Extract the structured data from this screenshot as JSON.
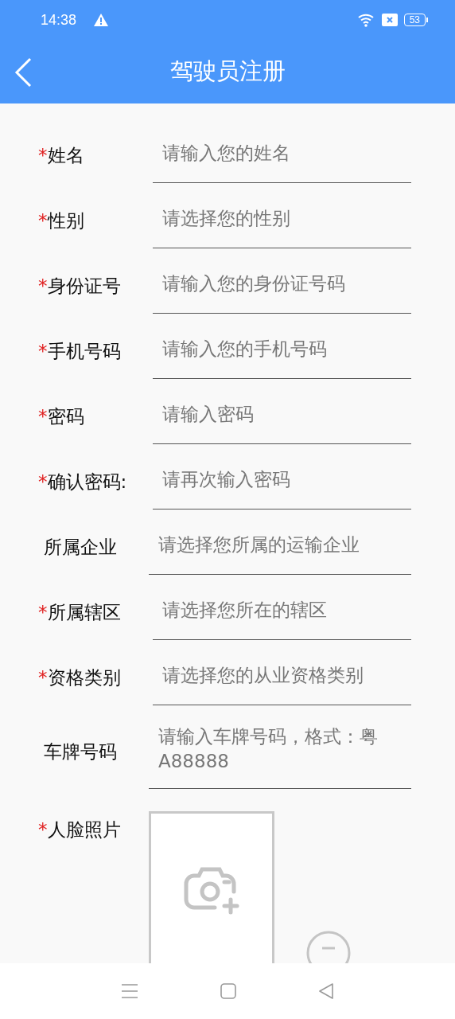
{
  "status_bar": {
    "time": "14:38",
    "battery": "53"
  },
  "header": {
    "title": "驾驶员注册"
  },
  "fields": [
    {
      "mark": "*",
      "label": "姓名",
      "placeholder": "请输入您的姓名"
    },
    {
      "mark": "*",
      "label": "性别",
      "placeholder": "请选择您的性别"
    },
    {
      "mark": "*",
      "label": "身份证号",
      "placeholder": "请输入您的身份证号码"
    },
    {
      "mark": "*",
      "label": "手机号码",
      "placeholder": "请输入您的手机号码"
    },
    {
      "mark": "*",
      "label": "密码",
      "placeholder": "请输入密码"
    },
    {
      "mark": "*",
      "label": "确认密码:",
      "placeholder": "请再次输入密码"
    },
    {
      "label": "所属企业",
      "placeholder": "请选择您所属的运输企业"
    },
    {
      "mark": "*",
      "label": "所属辖区",
      "placeholder": "请选择您所在的辖区"
    },
    {
      "mark": "*",
      "label": "资格类别",
      "placeholder": "请选择您的从业资格类别"
    },
    {
      "label": "车牌号码",
      "placeholder": "请输入车牌号码，格式：粤A88888"
    }
  ],
  "photo": {
    "mark": "*",
    "label": "人脸照片"
  }
}
